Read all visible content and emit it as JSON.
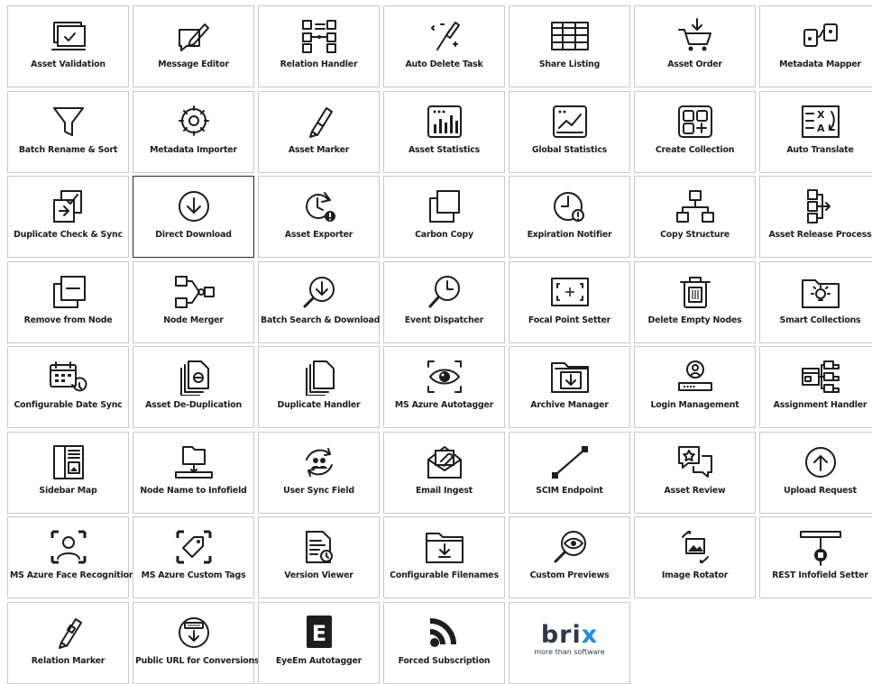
{
  "tiles": [
    {
      "label": "Asset Validation",
      "icon": "asset-validation-icon"
    },
    {
      "label": "Message Editor",
      "icon": "message-editor-icon"
    },
    {
      "label": "Relation Handler",
      "icon": "relation-handler-icon"
    },
    {
      "label": "Auto Delete Task",
      "icon": "auto-delete-task-icon"
    },
    {
      "label": "Share Listing",
      "icon": "share-listing-icon"
    },
    {
      "label": "Asset Order",
      "icon": "asset-order-icon"
    },
    {
      "label": "Metadata Mapper",
      "icon": "metadata-mapper-icon"
    },
    {
      "label": "Batch Rename & Sort",
      "icon": "batch-rename-sort-icon"
    },
    {
      "label": "Metadata Importer",
      "icon": "metadata-importer-icon"
    },
    {
      "label": "Asset Marker",
      "icon": "asset-marker-icon"
    },
    {
      "label": "Asset Statistics",
      "icon": "asset-statistics-icon"
    },
    {
      "label": "Global Statistics",
      "icon": "global-statistics-icon"
    },
    {
      "label": "Create Collection",
      "icon": "create-collection-icon"
    },
    {
      "label": "Auto Translate",
      "icon": "auto-translate-icon"
    },
    {
      "label": "Duplicate Check & Sync",
      "icon": "duplicate-check-sync-icon"
    },
    {
      "label": "Direct Download",
      "icon": "direct-download-icon"
    },
    {
      "label": "Asset Exporter",
      "icon": "asset-exporter-icon"
    },
    {
      "label": "Carbon Copy",
      "icon": "carbon-copy-icon"
    },
    {
      "label": "Expiration Notifier",
      "icon": "expiration-notifier-icon"
    },
    {
      "label": "Copy Structure",
      "icon": "copy-structure-icon"
    },
    {
      "label": "Asset Release Process",
      "icon": "asset-release-process-icon"
    },
    {
      "label": "Remove from Node",
      "icon": "remove-from-node-icon"
    },
    {
      "label": "Node Merger",
      "icon": "node-merger-icon"
    },
    {
      "label": "Batch Search & Download",
      "icon": "batch-search-download-icon"
    },
    {
      "label": "Event Dispatcher",
      "icon": "event-dispatcher-icon"
    },
    {
      "label": "Focal Point Setter",
      "icon": "focal-point-setter-icon"
    },
    {
      "label": "Delete Empty Nodes",
      "icon": "delete-empty-nodes-icon"
    },
    {
      "label": "Smart Collections",
      "icon": "smart-collections-icon"
    },
    {
      "label": "Configurable Date Sync",
      "icon": "configurable-date-sync-icon"
    },
    {
      "label": "Asset De-Duplication",
      "icon": "asset-de-duplication-icon"
    },
    {
      "label": "Duplicate Handler",
      "icon": "duplicate-handler-icon"
    },
    {
      "label": "MS Azure Autotagger",
      "icon": "ms-azure-autotagger-icon"
    },
    {
      "label": "Archive Manager",
      "icon": "archive-manager-icon"
    },
    {
      "label": "Login Management",
      "icon": "login-management-icon"
    },
    {
      "label": "Assignment Handler",
      "icon": "assignment-handler-icon"
    },
    {
      "label": "Sidebar Map",
      "icon": "sidebar-map-icon"
    },
    {
      "label": "Node Name to Infofield",
      "icon": "node-name-to-infofield-icon"
    },
    {
      "label": "User Sync Field",
      "icon": "user-sync-field-icon"
    },
    {
      "label": "Email Ingest",
      "icon": "email-ingest-icon"
    },
    {
      "label": "SCIM Endpoint",
      "icon": "scim-endpoint-icon"
    },
    {
      "label": "Asset Review",
      "icon": "asset-review-icon"
    },
    {
      "label": "Upload Request",
      "icon": "upload-request-icon"
    },
    {
      "label": "MS Azure Face Recognition",
      "icon": "ms-azure-face-recognition-icon"
    },
    {
      "label": "MS Azure Custom Tags",
      "icon": "ms-azure-custom-tags-icon"
    },
    {
      "label": "Version Viewer",
      "icon": "version-viewer-icon"
    },
    {
      "label": "Configurable Filenames",
      "icon": "configurable-filenames-icon"
    },
    {
      "label": "Custom Previews",
      "icon": "custom-previews-icon"
    },
    {
      "label": "Image Rotator",
      "icon": "image-rotator-icon"
    },
    {
      "label": "REST Infofield Setter",
      "icon": "rest-infofield-setter-icon"
    },
    {
      "label": "Relation Marker",
      "icon": "relation-marker-icon"
    },
    {
      "label": "Public URL for Conversions",
      "icon": "public-url-conversions-icon"
    },
    {
      "label": "EyeEm Autotagger",
      "icon": "eyeem-autotagger-icon",
      "glyph": "E"
    },
    {
      "label": "Forced Subscription",
      "icon": "forced-subscription-icon"
    }
  ],
  "focused_tile": "Direct Download",
  "brand": {
    "word_main": "bri",
    "word_accent": "x",
    "tagline": "more than software",
    "accent_color": "#1f8fe0",
    "text_color": "#2d3a4a"
  },
  "colors": {
    "border": "#c9c9c9",
    "text": "#1d1d1d",
    "icon": "#1d1d1d"
  }
}
